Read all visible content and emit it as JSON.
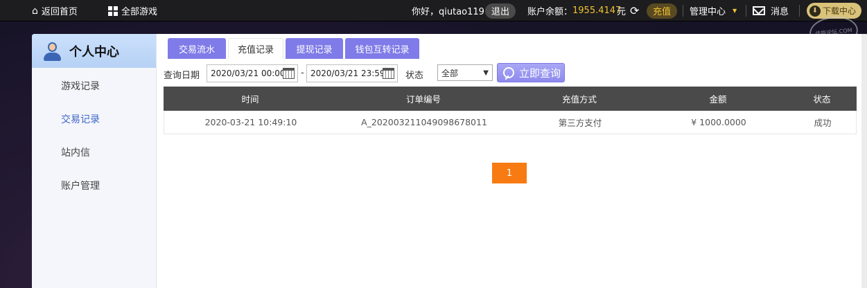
{
  "topbar": {
    "home": "返回首页",
    "all_games": "全部游戏",
    "greeting": "你好，qiutao119",
    "logout": "退出",
    "balance_label": "账户余额：",
    "balance_value": "1955.4147",
    "balance_unit": "元",
    "recharge": "充值",
    "admin": "管理中心",
    "messages": "消息",
    "download": "下载中心",
    "watermark_text": "佳能论坛.COM"
  },
  "sidebar": {
    "title": "个人中心",
    "items": [
      {
        "label": "游戏记录",
        "active": false
      },
      {
        "label": "交易记录",
        "active": true
      },
      {
        "label": "站内信",
        "active": false
      },
      {
        "label": "账户管理",
        "active": false
      }
    ]
  },
  "tabs": [
    {
      "label": "交易流水",
      "active": false
    },
    {
      "label": "充值记录",
      "active": true
    },
    {
      "label": "提现记录",
      "active": false
    },
    {
      "label": "钱包互转记录",
      "active": false
    }
  ],
  "filter": {
    "date_label": "查询日期",
    "start_date": "2020/03/21 00:00",
    "dash": "-",
    "end_date": "2020/03/21 23:59",
    "status_label": "状态",
    "status_value": "全部",
    "search_button": "立即查询"
  },
  "table": {
    "headers": [
      "时间",
      "订单编号",
      "充值方式",
      "金额",
      "状态"
    ],
    "rows": [
      [
        "2020-03-21 10:49:10",
        "A_20200321104909867801​1",
        "第三方支付",
        "¥ 1000.0000",
        "成功"
      ]
    ]
  },
  "pagination": {
    "current": "1"
  },
  "colors": {
    "tab_bg": "#7f7be8",
    "page_active": "#f77b12",
    "table_header": "#4a4a4a",
    "balance": "#f1c232"
  }
}
